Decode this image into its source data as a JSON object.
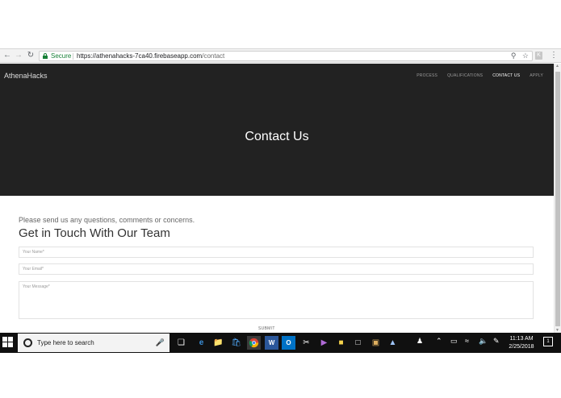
{
  "browser": {
    "secure_label": "Secure",
    "url_host": "https://athenahacks-7ca40.firebaseapp.com",
    "url_path": "/contact",
    "extension_label": "K"
  },
  "site": {
    "brand": "AthenaHacks",
    "nav": [
      "PROCESS",
      "QUALIFICATIONS",
      "CONTACT US",
      "APPLY"
    ],
    "active_nav": "CONTACT US",
    "hero_title": "Contact Us"
  },
  "contact": {
    "intro": "Please send us any questions, comments or concerns.",
    "heading": "Get in Touch With Our Team",
    "name_placeholder": "Your Name*",
    "email_placeholder": "Your Email*",
    "message_placeholder": "Your Message*",
    "submit_label": "SUBMIT"
  },
  "taskbar": {
    "search_placeholder": "Type here to search",
    "time": "11:13 AM",
    "date": "2/25/2018",
    "notification_count": "1"
  },
  "colors": {
    "hero_bg": "#222222",
    "secure_green": "#188038",
    "taskbar_bg": "#101010"
  }
}
